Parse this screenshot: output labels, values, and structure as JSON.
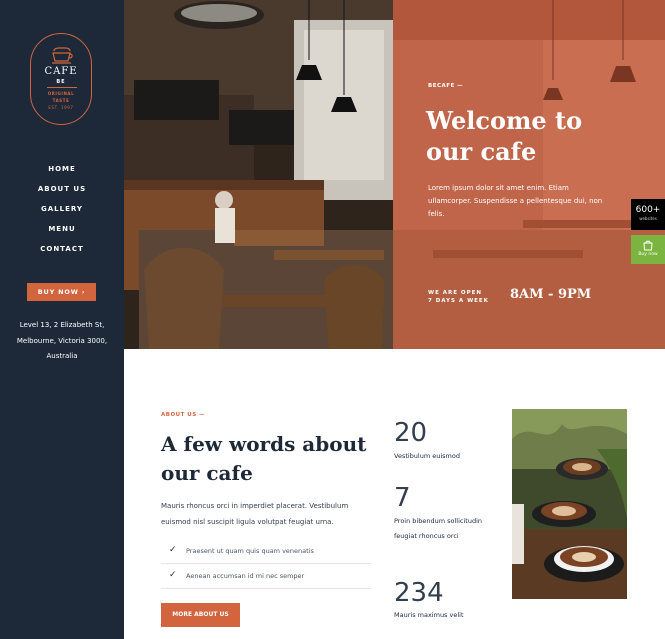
{
  "brand": {
    "name": "CAFE",
    "name2": "BE",
    "line1": "ORIGINAL",
    "line2": "TASTE",
    "line3": "EST. 1997"
  },
  "nav": [
    "HOME",
    "ABOUT US",
    "GALLERY",
    "MENU",
    "CONTACT"
  ],
  "buy_now": "BUY NOW  ›",
  "address": [
    "Level 13, 2 Elizabeth St,",
    "Melbourne, Victoria 3000,",
    "Australia"
  ],
  "hero": {
    "tagline": "BECAFE —",
    "title_1": "Welcome to",
    "title_2": "our cafe",
    "text": "Lorem ipsum dolor sit amet enim. Etiam ullamcorper. Suspendisse a pellentesque dui, non felis.",
    "open_1": "WE ARE OPEN",
    "open_2": "7 DAYS A WEEK",
    "hours": "8AM - 9PM"
  },
  "badges": {
    "sales": "600+",
    "sales_sub": "websites",
    "buy": "Buy now"
  },
  "about": {
    "label": "ABOUT US —",
    "heading_1": "A few words about",
    "heading_2": "our cafe",
    "paragraph": "Mauris rhoncus orci in imperdiet placerat. Vestibulum euismod nisl suscipit ligula volutpat feugiat urna.",
    "checks": [
      "Praesent ut quam quis quam venenatis",
      "Aenean accumsan id mi nec semper"
    ],
    "button": "MORE ABOUT US"
  },
  "stats": [
    {
      "number": "20",
      "label": "Vestibulum euismod"
    },
    {
      "number": "7",
      "label": "Proin bibendum sollicitudin feugiat rhoncus orci"
    },
    {
      "number": "234",
      "label": "Mauris maximus velit"
    }
  ],
  "colors": {
    "accent": "#d2643e",
    "sidebar": "#1d2939",
    "hero_overlay": "#c06549"
  },
  "icons": [
    "coffee-cup-icon",
    "check-icon",
    "shopping-bag-icon"
  ]
}
